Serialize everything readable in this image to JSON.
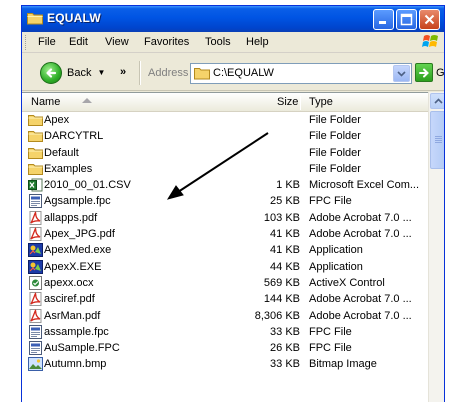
{
  "window": {
    "title": "EQUALW"
  },
  "menu": {
    "file": "File",
    "edit": "Edit",
    "view": "View",
    "favorites": "Favorites",
    "tools": "Tools",
    "help": "Help"
  },
  "toolbar": {
    "back_label": "Back",
    "forward_chevron": "»",
    "address_label": "Address",
    "address_value": "C:\\EQUALW",
    "go_label": "Go"
  },
  "list": {
    "columns": {
      "name": "Name",
      "size": "Size",
      "type": "Type"
    },
    "rows": [
      {
        "name": "Apex",
        "size": "",
        "type": "File Folder",
        "icon": "folder-icon"
      },
      {
        "name": "DARCYTRL",
        "size": "",
        "type": "File Folder",
        "icon": "folder-icon"
      },
      {
        "name": "Default",
        "size": "",
        "type": "File Folder",
        "icon": "folder-icon"
      },
      {
        "name": "Examples",
        "size": "",
        "type": "File Folder",
        "icon": "folder-icon"
      },
      {
        "name": "2010_00_01.CSV",
        "size": "1 KB",
        "type": "Microsoft Excel Com...",
        "icon": "excel-icon"
      },
      {
        "name": "Agsample.fpc",
        "size": "25 KB",
        "type": "FPC File",
        "icon": "generic-file-icon"
      },
      {
        "name": "allapps.pdf",
        "size": "103 KB",
        "type": "Adobe Acrobat 7.0 ...",
        "icon": "pdf-icon"
      },
      {
        "name": "Apex_JPG.pdf",
        "size": "41 KB",
        "type": "Adobe Acrobat 7.0 ...",
        "icon": "pdf-icon"
      },
      {
        "name": "ApexMed.exe",
        "size": "41 KB",
        "type": "Application",
        "icon": "app-icon"
      },
      {
        "name": "ApexX.EXE",
        "size": "44 KB",
        "type": "Application",
        "icon": "app-icon"
      },
      {
        "name": "apexx.ocx",
        "size": "569 KB",
        "type": "ActiveX Control",
        "icon": "activex-icon"
      },
      {
        "name": "asciref.pdf",
        "size": "144 KB",
        "type": "Adobe Acrobat 7.0 ...",
        "icon": "pdf-icon"
      },
      {
        "name": "AsrMan.pdf",
        "size": "8,306 KB",
        "type": "Adobe Acrobat 7.0 ...",
        "icon": "pdf-icon"
      },
      {
        "name": "assample.fpc",
        "size": "33 KB",
        "type": "FPC File",
        "icon": "generic-file-icon"
      },
      {
        "name": "AuSample.FPC",
        "size": "26 KB",
        "type": "FPC File",
        "icon": "generic-file-icon"
      },
      {
        "name": "Autumn.bmp",
        "size": "33 KB",
        "type": "Bitmap Image",
        "icon": "bitmap-icon"
      }
    ]
  },
  "colors": {
    "titlebar": "#0054e3",
    "folder": "#f5d36a",
    "pdf_red": "#d42a1f",
    "excel_green": "#1f7a2e",
    "arrow": "#000000"
  }
}
